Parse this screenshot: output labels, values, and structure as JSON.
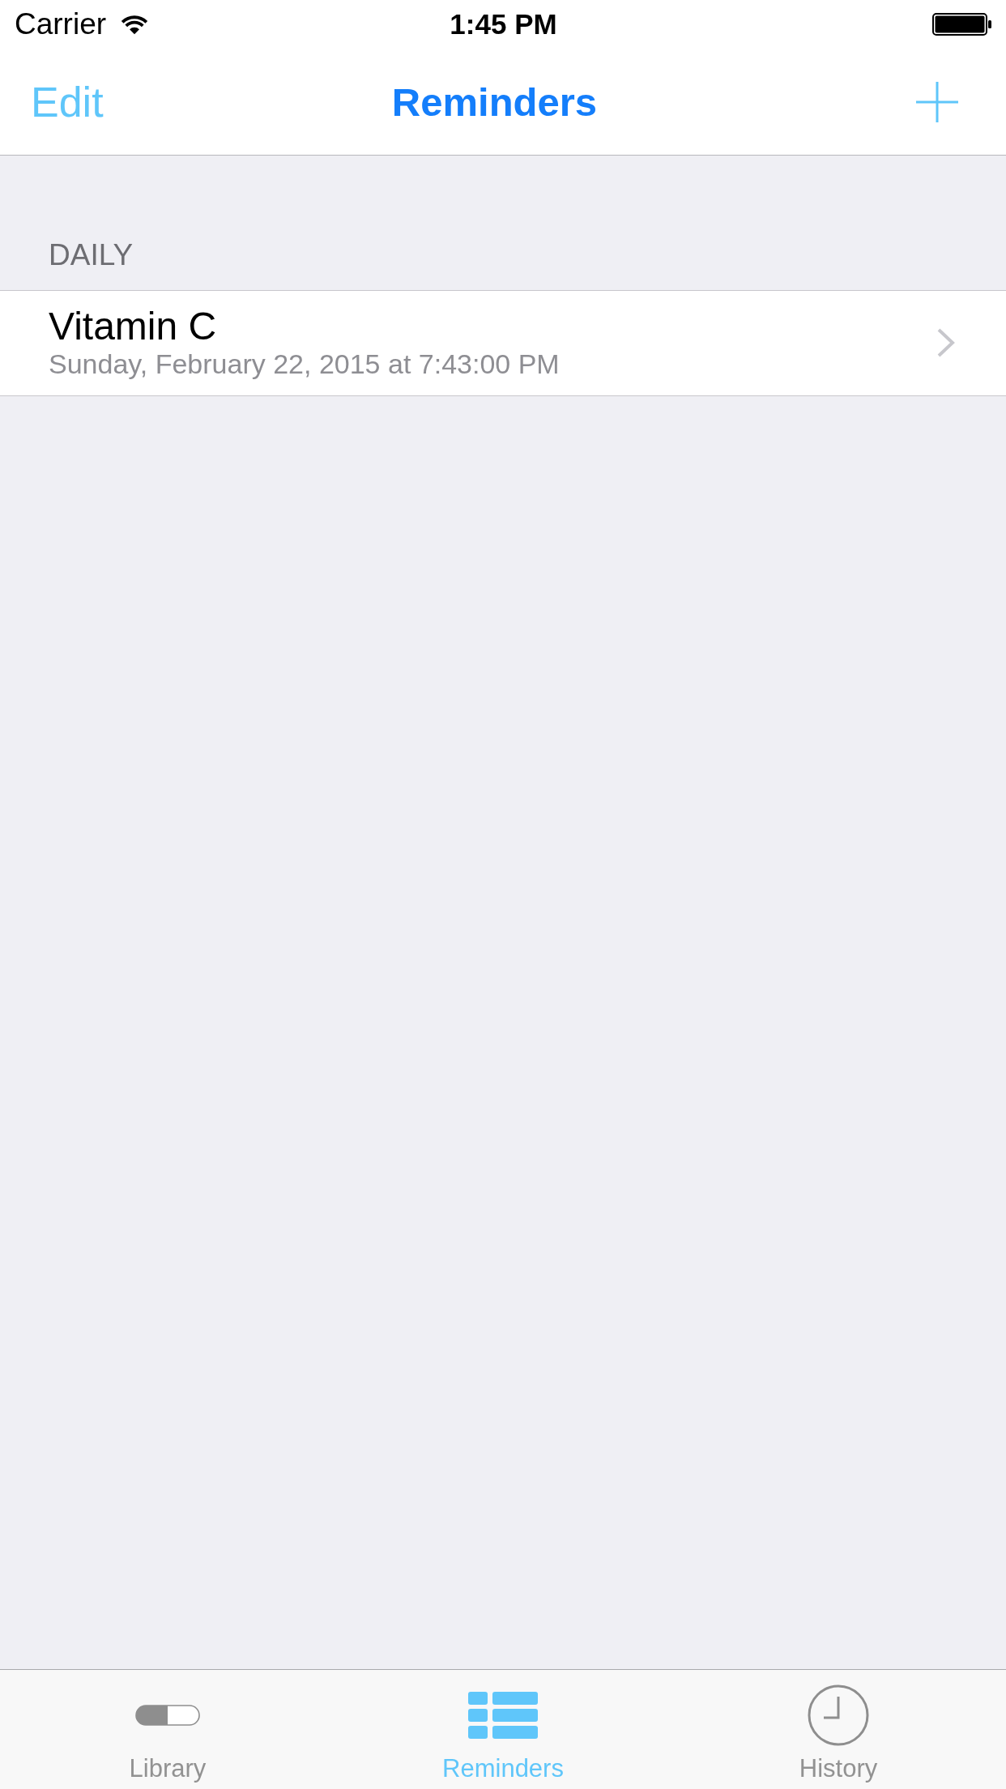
{
  "status_bar": {
    "carrier": "Carrier",
    "time": "1:45 PM"
  },
  "nav_bar": {
    "left_button": "Edit",
    "title": "Reminders"
  },
  "sections": [
    {
      "header": "DAILY",
      "rows": [
        {
          "title": "Vitamin C",
          "subtitle": "Sunday, February 22, 2015 at 7:43:00 PM"
        }
      ]
    }
  ],
  "tab_bar": {
    "tabs": [
      {
        "label": "Library",
        "kind": "pill",
        "selected": false
      },
      {
        "label": "Reminders",
        "kind": "list",
        "selected": true
      },
      {
        "label": "History",
        "kind": "clock",
        "selected": false
      }
    ]
  }
}
